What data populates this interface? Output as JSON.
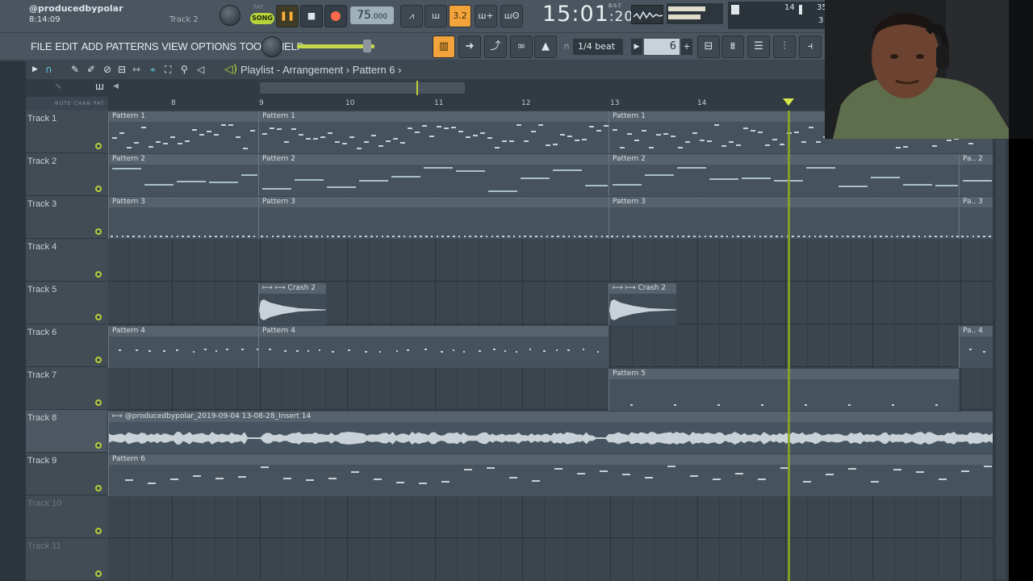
{
  "header": {
    "title": "@producedbypolar",
    "time": "8:14:09",
    "track_hint": "Track 2",
    "pat_label": "PAT",
    "song_label": "SONG",
    "tempo": "75",
    "tempo_decimal": ".000",
    "clock_main": "15:01",
    "clock_sub": ":20",
    "clock_units": "B:S:T",
    "mem_a": "14",
    "mem_b": "35",
    "mem_c": "3"
  },
  "menu": {
    "items": [
      "FILE",
      "EDIT",
      "ADD",
      "PATTERNS",
      "VIEW",
      "OPTIONS",
      "TOOLS",
      "HELP"
    ]
  },
  "toolbar": {
    "snap": "1/4 beat",
    "pattern_number": "6",
    "play_icon": "pause",
    "stop_icon": "stop"
  },
  "playlist": {
    "title": "Playlist - Arrangement",
    "sep": "›",
    "pattern": "Pattern 6",
    "sep2": "›",
    "snap_labels": "NOTE  CHAN  PAT",
    "bars": [
      "8",
      "9",
      "10",
      "11",
      "12",
      "13",
      "14"
    ]
  },
  "tracks": [
    {
      "label": "Track 1"
    },
    {
      "label": "Track 2"
    },
    {
      "label": "Track 3"
    },
    {
      "label": "Track 4"
    },
    {
      "label": "Track 5"
    },
    {
      "label": "Track 6"
    },
    {
      "label": "Track 7"
    },
    {
      "label": "Track 8"
    },
    {
      "label": "Track 9"
    },
    {
      "label": "Track 10"
    },
    {
      "label": "Track 11"
    }
  ],
  "clips": {
    "t1": [
      "Pattern 1",
      "Pattern 1",
      "Pattern 1"
    ],
    "t2": [
      "Pattern 2",
      "Pattern 2",
      "Pattern 2",
      "Pa.. 2"
    ],
    "t3": [
      "Pattern 3",
      "Pattern 3",
      "Pattern 3",
      "Pa.. 3"
    ],
    "t5": [
      "Crash 2",
      "Crash 2"
    ],
    "t6": [
      "Pattern 4",
      "Pattern 4",
      "Pa.. 4"
    ],
    "t7": [
      "Pattern 5"
    ],
    "t8": [
      "@producedbypolar_2019-09-04 13-08-28_Insert 14"
    ],
    "t9": [
      "Pattern 6"
    ]
  },
  "colors": {
    "accent": "#b8d03a",
    "playhead": "#8faa1e",
    "background": "#3a454e"
  }
}
